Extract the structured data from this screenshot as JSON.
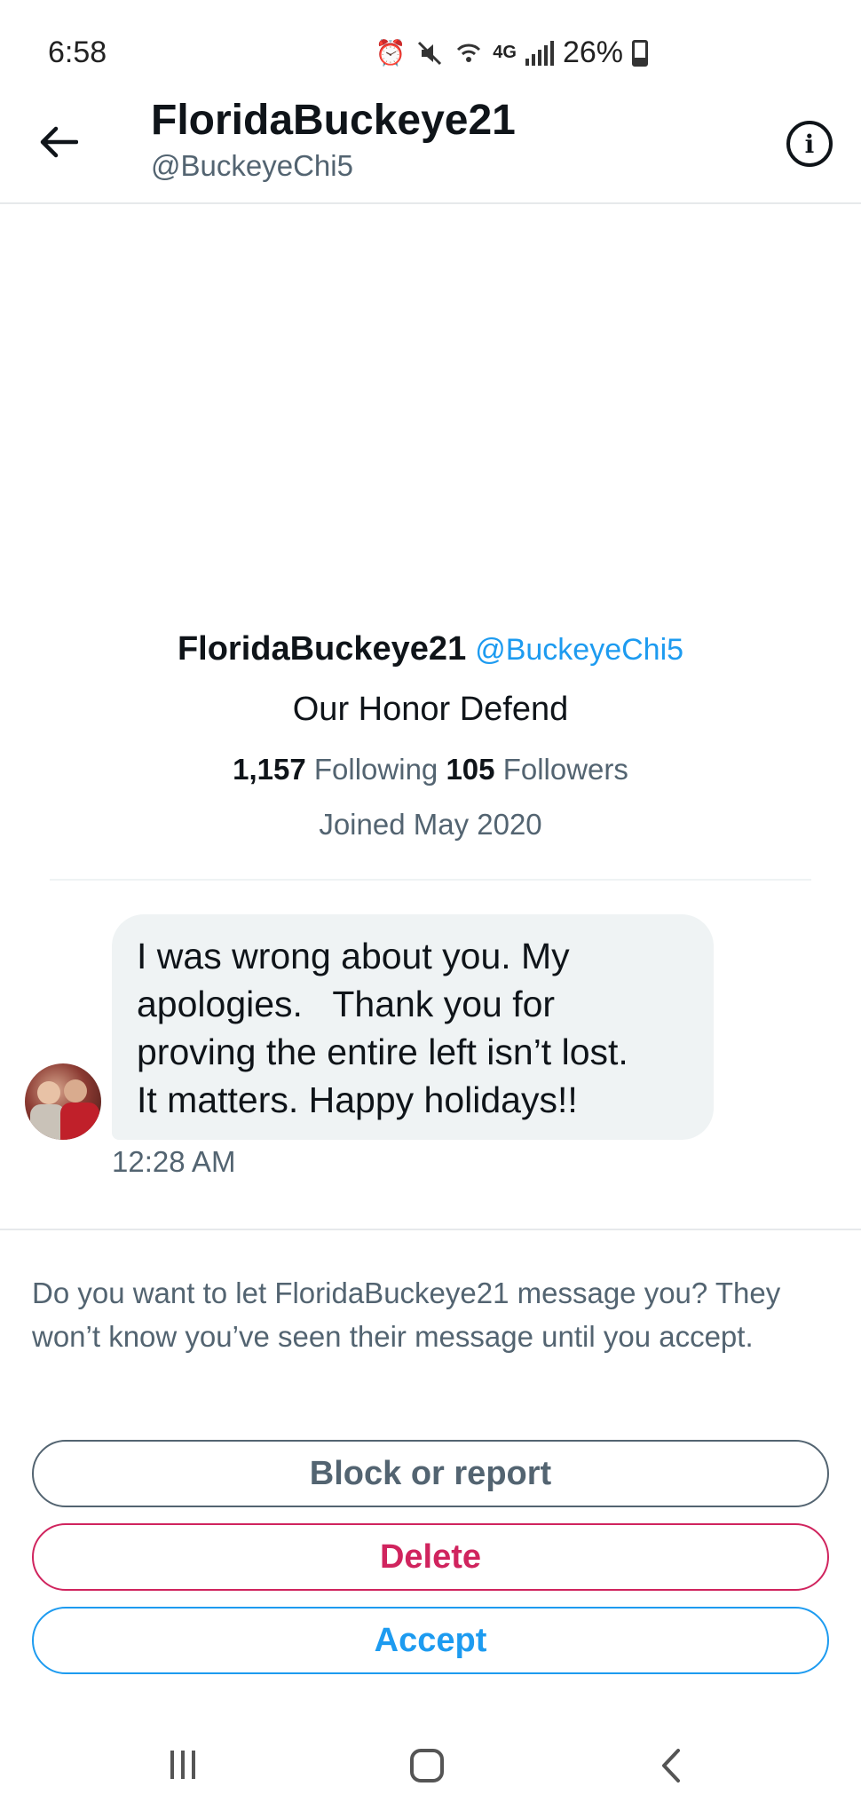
{
  "status_bar": {
    "time": "6:58",
    "battery": "26%",
    "network": "4G",
    "icons": [
      "alarm-icon",
      "mute-icon",
      "wifi-icon",
      "4g-icon",
      "signal-icon",
      "battery-icon"
    ]
  },
  "header": {
    "name": "FloridaBuckeye21",
    "handle": "@BuckeyeChi5"
  },
  "profile": {
    "name": "FloridaBuckeye21",
    "handle": "@BuckeyeChi5",
    "bio": "Our Honor Defend",
    "following_count": "1,157",
    "following_label": "Following",
    "followers_count": "105",
    "followers_label": "Followers",
    "joined": "Joined May 2020"
  },
  "message": {
    "text": "I was wrong about you. My\napologies.   Thank you for\nproving the entire left isn’t lost.\nIt matters. Happy holidays!!",
    "time": "12:28 AM"
  },
  "request": {
    "prompt": "Do you want to let FloridaBuckeye21 message you? They won’t know you’ve seen their message until you accept.",
    "block_label": "Block or report",
    "delete_label": "Delete",
    "accept_label": "Accept"
  },
  "colors": {
    "accent": "#1d9bf0",
    "danger": "#d0245e",
    "secondary_text": "#536471",
    "bubble": "#eff3f4"
  }
}
